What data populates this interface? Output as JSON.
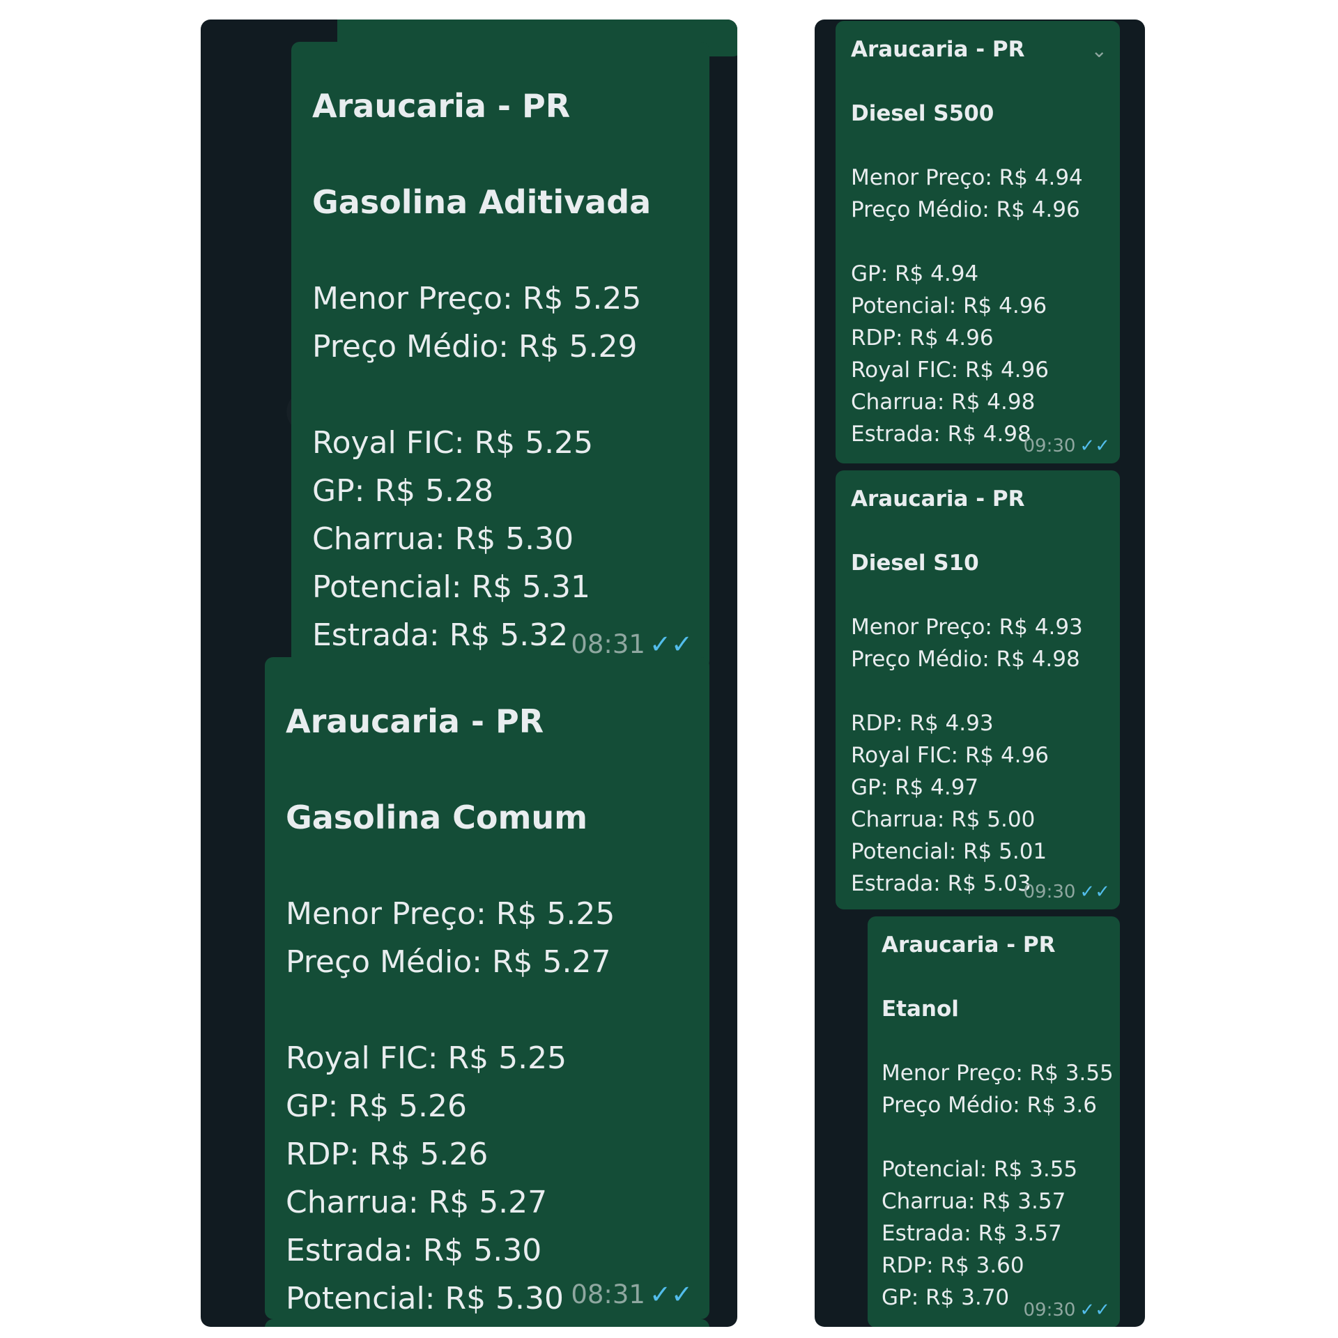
{
  "left_panel": {
    "aditivada": {
      "title": "Araucaria - PR",
      "product": "Gasolina Aditivada",
      "summary": [
        "Menor Preço: R$ 5.25",
        "Preço Médio: R$ 5.29"
      ],
      "stations": [
        "Royal FIC: R$ 5.25",
        "GP: R$ 5.28",
        "Charrua: R$ 5.30",
        "Potencial: R$ 5.31",
        "Estrada: R$ 5.32"
      ],
      "time": "08:31"
    },
    "comum": {
      "title": "Araucaria - PR",
      "product": "Gasolina Comum",
      "summary": [
        "Menor Preço: R$ 5.25",
        "Preço Médio: R$ 5.27"
      ],
      "stations": [
        "Royal FIC: R$ 5.25",
        "GP: R$ 5.26",
        "RDP: R$ 5.26",
        "Charrua: R$ 5.27",
        "Estrada: R$ 5.30",
        "Potencial: R$ 5.30"
      ],
      "time": "08:31"
    }
  },
  "right_panel": {
    "s500": {
      "title": "Araucaria - PR",
      "product": "Diesel S500",
      "summary": [
        "Menor Preço: R$ 4.94",
        "Preço Médio: R$ 4.96"
      ],
      "stations": [
        "GP: R$ 4.94",
        "Potencial: R$ 4.96",
        "RDP: R$ 4.96",
        "Royal FIC: R$ 4.96",
        "Charrua: R$ 4.98",
        "Estrada: R$ 4.98"
      ],
      "time": "09:30"
    },
    "s10": {
      "title": "Araucaria - PR",
      "product": "Diesel S10",
      "summary": [
        "Menor Preço: R$ 4.93",
        "Preço Médio: R$ 4.98"
      ],
      "stations": [
        "RDP: R$ 4.93",
        "Royal FIC: R$ 4.96",
        "GP: R$ 4.97",
        "Charrua: R$ 5.00",
        "Potencial: R$ 5.01",
        "Estrada: R$ 5.03"
      ],
      "time": "09:30"
    },
    "etanol": {
      "title": "Araucaria - PR",
      "product": "Etanol",
      "summary": [
        "Menor Preço: R$ 3.55",
        "Preço Médio: R$ 3.6"
      ],
      "stations": [
        "Potencial: R$ 3.55",
        "Charrua: R$ 3.57",
        "Estrada: R$ 3.57",
        "RDP: R$ 3.60",
        "GP: R$ 3.70"
      ],
      "time": "09:30"
    }
  },
  "icons": {
    "read_ticks": "✓✓",
    "chevron": "⌄"
  },
  "colors": {
    "panel_bg": "#111b21",
    "bubble_bg": "#144d37",
    "text": "#e9edef",
    "meta": "#8fa7a0",
    "ticks": "#53bdeb"
  }
}
